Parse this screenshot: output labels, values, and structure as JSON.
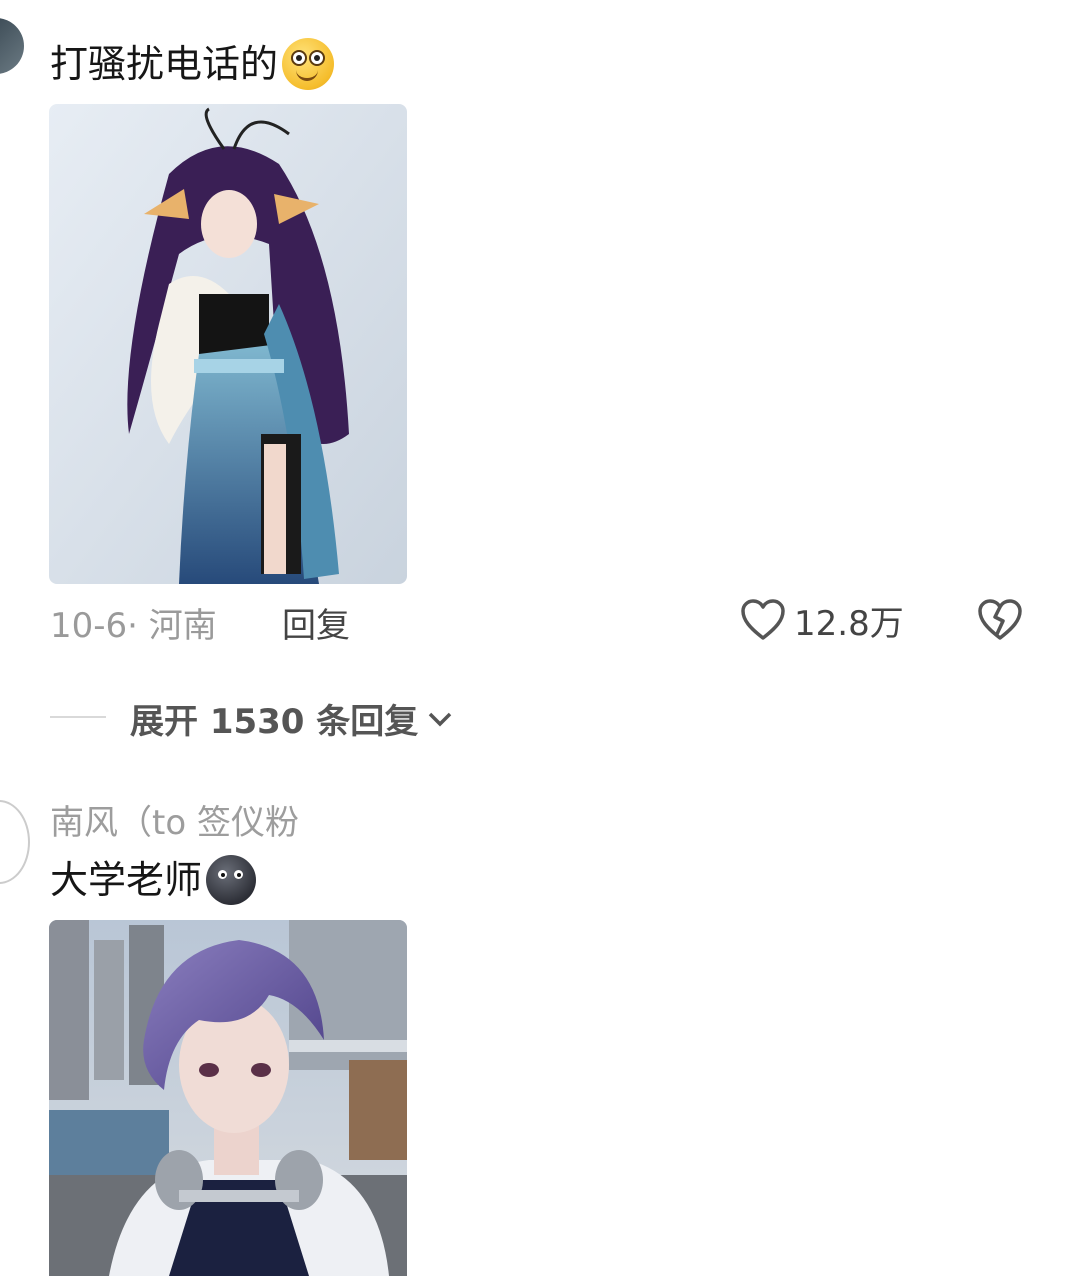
{
  "comment1": {
    "text": "打骚扰电话的",
    "emoji": "smiling-face-emoji",
    "image": "cosplay-photo-purple-hair-blue-dress",
    "date_location": "10-6· 河南",
    "reply_label": "回复",
    "like_count": "12.8万",
    "icons": [
      "heart-outline-icon",
      "broken-heart-icon"
    ]
  },
  "expand": {
    "label": "展开 1530 条回复",
    "icon": "chevron-down-icon"
  },
  "comment2": {
    "username": "南风（to 签仪粉",
    "text": "大学老师",
    "emoji": "dark-face-emoji",
    "image": "cosplay-photo-purple-hair-headphones"
  },
  "colors": {
    "meta_gray": "#9a9a9a",
    "text_dark": "#161616"
  }
}
